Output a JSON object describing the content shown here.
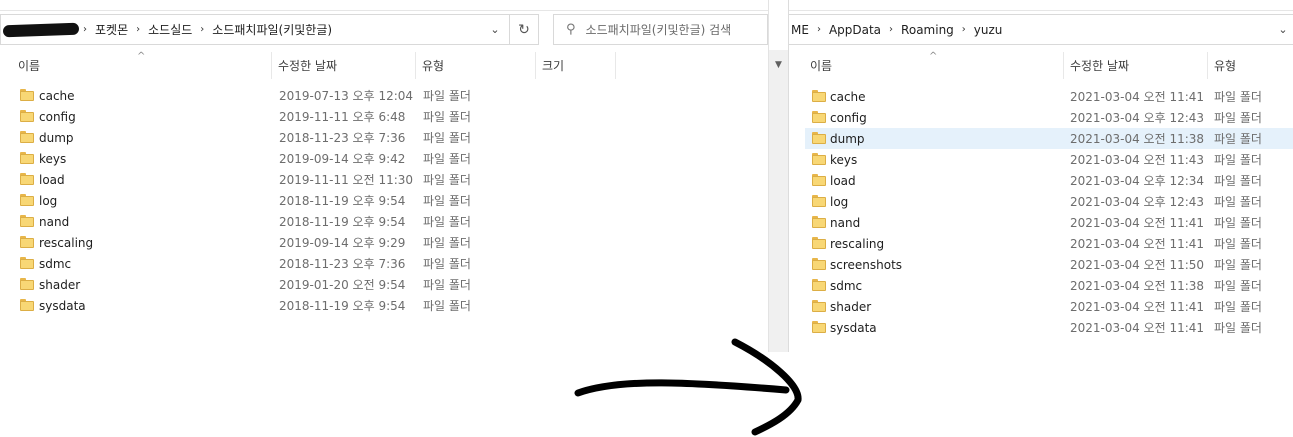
{
  "left_window": {
    "breadcrumb": [
      "포켓몬",
      "소드실드",
      "소드패치파일(키및한글)"
    ],
    "search_placeholder": "소드패치파일(키및한글) 검색",
    "columns": {
      "name": "이름",
      "date": "수정한 날짜",
      "type": "유형",
      "size": "크기"
    },
    "rows": [
      {
        "name": "cache",
        "date": "2019-07-13 오후 12:04",
        "type": "파일 폴더"
      },
      {
        "name": "config",
        "date": "2019-11-11 오후 6:48",
        "type": "파일 폴더"
      },
      {
        "name": "dump",
        "date": "2018-11-23 오후 7:36",
        "type": "파일 폴더"
      },
      {
        "name": "keys",
        "date": "2019-09-14 오후 9:42",
        "type": "파일 폴더"
      },
      {
        "name": "load",
        "date": "2019-11-11 오전 11:30",
        "type": "파일 폴더"
      },
      {
        "name": "log",
        "date": "2018-11-19 오후 9:54",
        "type": "파일 폴더"
      },
      {
        "name": "nand",
        "date": "2018-11-19 오후 9:54",
        "type": "파일 폴더"
      },
      {
        "name": "rescaling",
        "date": "2019-09-14 오후 9:29",
        "type": "파일 폴더"
      },
      {
        "name": "sdmc",
        "date": "2018-11-23 오후 7:36",
        "type": "파일 폴더"
      },
      {
        "name": "shader",
        "date": "2019-01-20 오전 9:54",
        "type": "파일 폴더"
      },
      {
        "name": "sysdata",
        "date": "2018-11-19 오후 9:54",
        "type": "파일 폴더"
      }
    ]
  },
  "right_window": {
    "breadcrumb": [
      "ME",
      "AppData",
      "Roaming",
      "yuzu"
    ],
    "columns": {
      "name": "이름",
      "date": "수정한 날짜",
      "type": "유형"
    },
    "selected_row": "dump",
    "rows": [
      {
        "name": "cache",
        "date": "2021-03-04 오전 11:41",
        "type": "파일 폴더"
      },
      {
        "name": "config",
        "date": "2021-03-04 오후 12:43",
        "type": "파일 폴더"
      },
      {
        "name": "dump",
        "date": "2021-03-04 오전 11:38",
        "type": "파일 폴더"
      },
      {
        "name": "keys",
        "date": "2021-03-04 오전 11:43",
        "type": "파일 폴더"
      },
      {
        "name": "load",
        "date": "2021-03-04 오후 12:34",
        "type": "파일 폴더"
      },
      {
        "name": "log",
        "date": "2021-03-04 오후 12:43",
        "type": "파일 폴더"
      },
      {
        "name": "nand",
        "date": "2021-03-04 오전 11:41",
        "type": "파일 폴더"
      },
      {
        "name": "rescaling",
        "date": "2021-03-04 오전 11:41",
        "type": "파일 폴더"
      },
      {
        "name": "screenshots",
        "date": "2021-03-04 오전 11:50",
        "type": "파일 폴더"
      },
      {
        "name": "sdmc",
        "date": "2021-03-04 오전 11:38",
        "type": "파일 폴더"
      },
      {
        "name": "shader",
        "date": "2021-03-04 오전 11:41",
        "type": "파일 폴더"
      },
      {
        "name": "sysdata",
        "date": "2021-03-04 오전 11:41",
        "type": "파일 폴더"
      }
    ]
  },
  "icons": {
    "folder": "folder-icon",
    "refresh": "refresh-icon",
    "search": "search-icon",
    "dropdown": "chevron-down-icon",
    "separator": "chevron-right-icon",
    "annotation": "hand-drawn-arrow"
  },
  "colors": {
    "folder_fill": "#f8d775",
    "selection": "#e5f1fb",
    "arrow": "#000000"
  }
}
